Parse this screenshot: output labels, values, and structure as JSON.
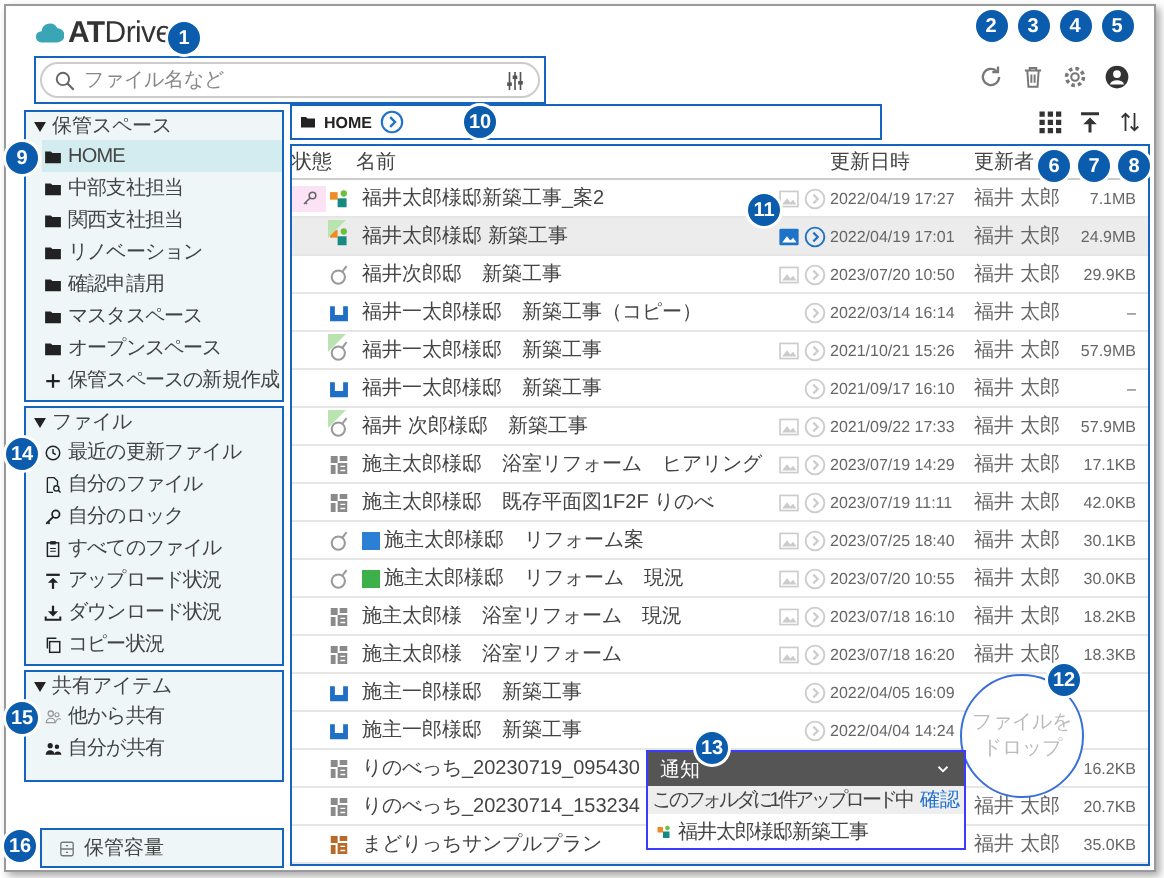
{
  "header": {
    "logo": "**AT**Drive",
    "search": {
      "placeholder": "ファイル名など",
      "callout": "1"
    },
    "actions": [
      {
        "kind": "refresh",
        "callout": "2"
      },
      {
        "kind": "trash",
        "callout": "3"
      },
      {
        "kind": "settings",
        "callout": "4"
      },
      {
        "kind": "account",
        "callout": "5"
      }
    ]
  },
  "sidebar": {
    "sections": [
      {
        "title": "保管スペース",
        "expanded": true,
        "callout": "9",
        "items": [
          {
            "label": "HOME",
            "kind": "folder",
            "selected": true
          },
          {
            "label": "中部支社担当",
            "kind": "folder",
            "selected": false
          },
          {
            "label": "関西支社担当",
            "kind": "folder",
            "selected": false
          },
          {
            "label": "リノベーション",
            "kind": "folder",
            "selected": false
          },
          {
            "label": "確認申請用",
            "kind": "folder",
            "selected": false
          },
          {
            "label": "マスタスペース",
            "kind": "folder",
            "selected": false
          },
          {
            "label": "オープンスペース",
            "kind": "folder",
            "selected": false
          },
          {
            "label": "保管スペースの新規作成",
            "kind": "plus",
            "selected": false
          }
        ]
      },
      {
        "title": "ファイル",
        "expanded": true,
        "callout": "14",
        "items": [
          {
            "label": "最近の更新ファイル",
            "kind": "clock",
            "selected": false
          },
          {
            "label": "自分のファイル",
            "kind": "file-search",
            "selected": false
          },
          {
            "label": "自分のロック",
            "kind": "key",
            "selected": false
          },
          {
            "label": "すべてのファイル",
            "kind": "clipboard",
            "selected": false
          },
          {
            "label": "アップロード状況",
            "kind": "upload",
            "selected": false
          },
          {
            "label": "ダウンロード状況",
            "kind": "download",
            "selected": false
          },
          {
            "label": "コピー状況",
            "kind": "copy",
            "selected": false
          }
        ]
      },
      {
        "title": "共有アイテム",
        "expanded": true,
        "callout": "15",
        "items": [
          {
            "label": "他から共有",
            "kind": "shared-in",
            "selected": false
          },
          {
            "label": "自分が共有",
            "kind": "shared-out",
            "selected": false
          }
        ]
      }
    ],
    "storage": {
      "label": "保管容量",
      "callout": "16"
    }
  },
  "toolbar": {
    "breadcrumb": {
      "label": "HOME",
      "callout": "10"
    },
    "actions": [
      {
        "kind": "grid",
        "callout": "6"
      },
      {
        "kind": "upload",
        "callout": "7"
      },
      {
        "kind": "sort",
        "callout": "8"
      }
    ]
  },
  "table": {
    "columns": [
      "状態",
      "名前",
      "更新日時",
      "更新者"
    ],
    "preview_callout": "11",
    "rows": [
      {
        "name": "福井太郎様邸新築工事_案2",
        "kind": "multi",
        "locked": true,
        "mark": false,
        "selected": false,
        "image": true,
        "play": true,
        "date": "2022/04/19 17:27",
        "author": "福井 太郎",
        "size": "7.1MB"
      },
      {
        "name": "福井太郎様邸 新築工事",
        "kind": "multi",
        "locked": false,
        "mark": true,
        "selected": true,
        "image": true,
        "play": true,
        "date": "2022/04/19 17:01",
        "author": "福井 太郎",
        "size": "24.9MB"
      },
      {
        "name": "福井次郎邸　新築工事",
        "kind": "ring",
        "locked": false,
        "mark": false,
        "selected": false,
        "image": true,
        "play": true,
        "date": "2023/07/20 10:50",
        "author": "福井 太郎",
        "size": "29.9KB"
      },
      {
        "name": "福井一太郎様邸　新築工事（コピー）",
        "kind": "tray",
        "locked": false,
        "mark": false,
        "selected": false,
        "image": false,
        "play": true,
        "date": "2022/03/14 16:14",
        "author": "福井 太郎",
        "size": "–"
      },
      {
        "name": "福井一太郎様邸　新築工事",
        "kind": "ring",
        "locked": false,
        "mark": true,
        "selected": false,
        "image": true,
        "play": true,
        "date": "2021/10/21 15:26",
        "author": "福井 太郎",
        "size": "57.9MB"
      },
      {
        "name": "福井一太郎様邸　新築工事",
        "kind": "tray",
        "locked": false,
        "mark": false,
        "selected": false,
        "image": false,
        "play": true,
        "date": "2021/09/17 16:10",
        "author": "福井 太郎",
        "size": "–"
      },
      {
        "name": "福井 次郎様邸　新築工事",
        "kind": "ring",
        "locked": false,
        "mark": true,
        "selected": false,
        "image": true,
        "play": true,
        "date": "2021/09/22 17:33",
        "author": "福井 太郎",
        "size": "57.9MB"
      },
      {
        "name": "施主太郎様邸　浴室リフォーム　ヒアリング",
        "kind": "plan",
        "locked": false,
        "mark": false,
        "selected": false,
        "image": true,
        "play": true,
        "date": "2023/07/19 14:29",
        "author": "福井 太郎",
        "size": "17.1KB"
      },
      {
        "name": "施主太郎様邸　既存平面図1F2F りのべ",
        "kind": "plan",
        "locked": false,
        "mark": false,
        "selected": false,
        "image": true,
        "play": true,
        "date": "2023/07/19 11:11",
        "author": "福井 太郎",
        "size": "42.0KB"
      },
      {
        "name": "施主太郎様邸　リフォーム案",
        "kind": "ring",
        "color": "#2b7fd4",
        "locked": false,
        "mark": false,
        "selected": false,
        "image": true,
        "play": true,
        "date": "2023/07/25 18:40",
        "author": "福井 太郎",
        "size": "30.1KB"
      },
      {
        "name": "施主太郎様邸　リフォーム　現況",
        "kind": "ring",
        "color": "#3db04a",
        "locked": false,
        "mark": false,
        "selected": false,
        "image": true,
        "play": true,
        "date": "2023/07/20 10:55",
        "author": "福井 太郎",
        "size": "30.0KB"
      },
      {
        "name": "施主太郎様　浴室リフォーム　現況",
        "kind": "plan",
        "locked": false,
        "mark": false,
        "selected": false,
        "image": true,
        "play": true,
        "date": "2023/07/18 16:10",
        "author": "福井 太郎",
        "size": "18.2KB"
      },
      {
        "name": "施主太郎様　浴室リフォーム",
        "kind": "plan",
        "locked": false,
        "mark": false,
        "selected": false,
        "image": true,
        "play": true,
        "date": "2023/07/18 16:20",
        "author": "福井 太郎",
        "size": "18.3KB"
      },
      {
        "name": "施主一郎様邸　新築工事",
        "kind": "tray",
        "locked": false,
        "mark": false,
        "selected": false,
        "image": false,
        "play": true,
        "date": "2022/04/05 16:09"
      },
      {
        "name": "施主一郎様邸　新築工事",
        "kind": "tray",
        "locked": false,
        "mark": false,
        "selected": false,
        "image": false,
        "play": true,
        "date": "2022/04/04 14:24"
      },
      {
        "name": "りのべっち_20230719_095430",
        "kind": "plan",
        "locked": false,
        "mark": false,
        "selected": false,
        "image": false,
        "play": false,
        "size": "16.2KB"
      },
      {
        "name": "りのべっち_20230714_153234",
        "kind": "plan",
        "locked": false,
        "mark": false,
        "selected": false,
        "image": false,
        "play": false,
        "author": "福井 太郎",
        "size": "20.7KB"
      },
      {
        "name": "まどりっちサンプルプラン",
        "kind": "plan-color",
        "locked": false,
        "mark": false,
        "selected": false,
        "image": false,
        "play": false,
        "author": "福井 太郎",
        "size": "35.0KB"
      }
    ]
  },
  "drop_zone": {
    "text": "ファイルをドロップ",
    "callout": "12"
  },
  "notification": {
    "title": "通知",
    "message": "このフォルダに1件アップロード中",
    "action": "確認",
    "callout": "13",
    "items": [
      {
        "name": "福井太郎様邸新築工事",
        "kind": "multi"
      }
    ]
  }
}
